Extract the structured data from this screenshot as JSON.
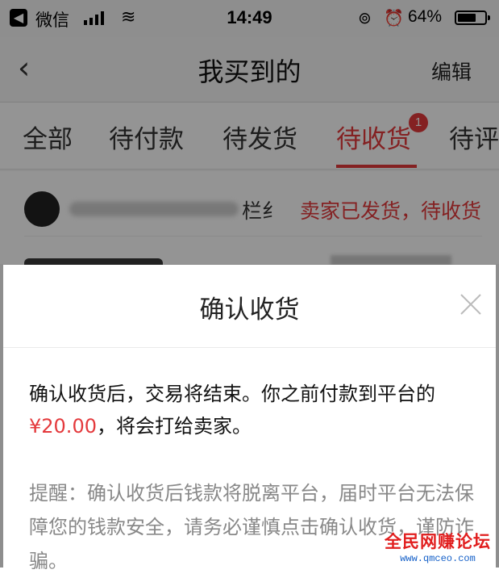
{
  "status_bar": {
    "carrier": "微信",
    "time": "14:49",
    "battery": "64%",
    "icons": [
      "back-app-icon",
      "signal-icon",
      "wifi-icon",
      "rotation-lock-icon",
      "alarm-icon",
      "battery-icon"
    ]
  },
  "nav": {
    "back_icon": "‹",
    "title": "我买到的",
    "edit": "编辑"
  },
  "tabs": [
    {
      "label": "全部"
    },
    {
      "label": "待付款"
    },
    {
      "label": "待发货"
    },
    {
      "label": "待收货",
      "active": true,
      "badge": "1"
    },
    {
      "label": "待评"
    }
  ],
  "order": {
    "shop_name_partial": "栏纟",
    "status": "卖家已发货，待收货"
  },
  "dialog": {
    "title": "确认收货",
    "message_part1": "确认收货后，交易将结束。你之前付款到平台的",
    "price": "¥20.00",
    "message_part2": "，将会打给卖家。",
    "warning": "提醒：确认收货后钱款将脱离平台，届时平台无法保障您的钱款安全，请务必谨慎点击确认收货，谨防诈骗。"
  },
  "watermark": {
    "title": "全民网赚论坛",
    "url": "www.qmceo.com"
  },
  "colors": {
    "accent": "#e4393c",
    "overlay": "rgba(0,0,0,0.42)",
    "muted_text": "#888888"
  }
}
